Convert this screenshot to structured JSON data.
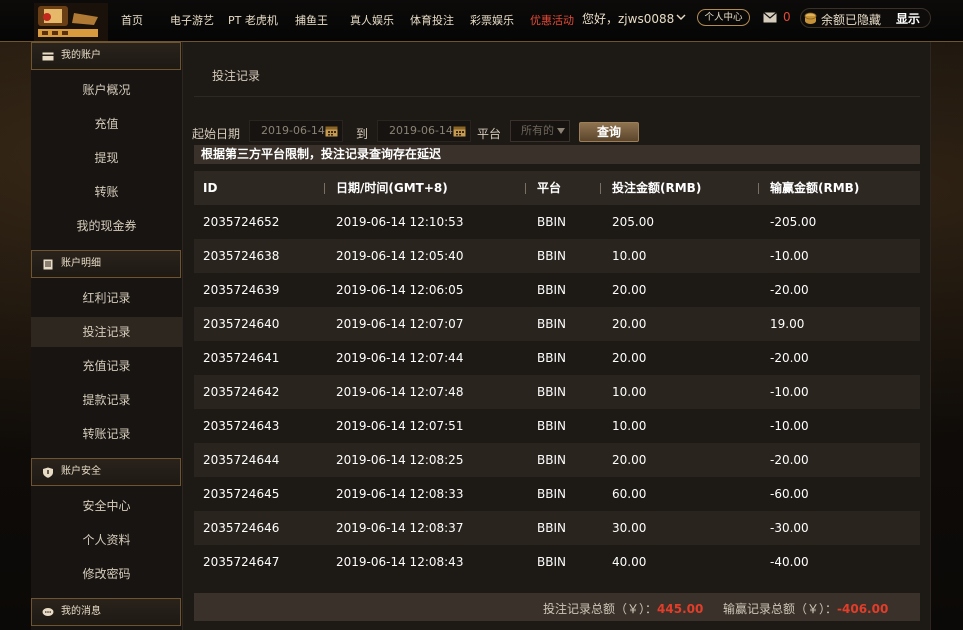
{
  "nav": {
    "items": [
      {
        "label": "首页",
        "promo": false
      },
      {
        "label": "电子游艺",
        "promo": false
      },
      {
        "label": "PT 老虎机",
        "promo": false
      },
      {
        "label": "捕鱼王",
        "promo": false
      },
      {
        "label": "真人娱乐",
        "promo": false
      },
      {
        "label": "体育投注",
        "promo": false
      },
      {
        "label": "彩票娱乐",
        "promo": false
      },
      {
        "label": "优惠活动",
        "promo": true
      }
    ],
    "greeting": "您好，zjws0088",
    "user_center": "个人中心",
    "mail_count": "0",
    "balance_text": "余额已隐藏",
    "show_label": "显示"
  },
  "sidebar": {
    "sections": [
      {
        "title": "我的账户",
        "icon": "card-icon",
        "items": [
          "账户概况",
          "充值",
          "提现",
          "转账",
          "我的现金券"
        ]
      },
      {
        "title": "账户明细",
        "icon": "ledger-icon",
        "items": [
          "红利记录",
          "投注记录",
          "充值记录",
          "提款记录",
          "转账记录"
        ]
      },
      {
        "title": "账户安全",
        "icon": "shield-icon",
        "items": [
          "安全中心",
          "个人资料",
          "修改密码"
        ]
      },
      {
        "title": "我的消息",
        "icon": "chat-icon",
        "items": []
      }
    ],
    "active_item": "投注记录"
  },
  "main": {
    "page_title": "投注记录",
    "filters": {
      "start_label": "起始日期",
      "start_date": "2019-06-14",
      "to_label": "到",
      "end_date": "2019-06-14",
      "platform_label": "平台",
      "platform_value": "所有的",
      "query_label": "查询"
    },
    "notice": "根据第三方平台限制，投注记录查询存在延迟",
    "table": {
      "headers": [
        "ID",
        "日期/时间(GMT+8)",
        "平台",
        "投注金额(RMB)",
        "输赢金额(RMB)"
      ],
      "rows": [
        [
          "2035724652",
          "2019-06-14 12:10:53",
          "BBIN",
          "205.00",
          "-205.00"
        ],
        [
          "2035724638",
          "2019-06-14 12:05:40",
          "BBIN",
          "10.00",
          "-10.00"
        ],
        [
          "2035724639",
          "2019-06-14 12:06:05",
          "BBIN",
          "20.00",
          "-20.00"
        ],
        [
          "2035724640",
          "2019-06-14 12:07:07",
          "BBIN",
          "20.00",
          "19.00"
        ],
        [
          "2035724641",
          "2019-06-14 12:07:44",
          "BBIN",
          "20.00",
          "-20.00"
        ],
        [
          "2035724642",
          "2019-06-14 12:07:48",
          "BBIN",
          "10.00",
          "-10.00"
        ],
        [
          "2035724643",
          "2019-06-14 12:07:51",
          "BBIN",
          "10.00",
          "-10.00"
        ],
        [
          "2035724644",
          "2019-06-14 12:08:25",
          "BBIN",
          "20.00",
          "-20.00"
        ],
        [
          "2035724645",
          "2019-06-14 12:08:33",
          "BBIN",
          "60.00",
          "-60.00"
        ],
        [
          "2035724646",
          "2019-06-14 12:08:37",
          "BBIN",
          "30.00",
          "-30.00"
        ],
        [
          "2035724647",
          "2019-06-14 12:08:43",
          "BBIN",
          "40.00",
          "-40.00"
        ]
      ]
    },
    "footer": {
      "bet_total_label": "投注记录总额（￥）：",
      "bet_total_value": "445.00",
      "win_total_label": "输赢记录总额（￥）：",
      "win_total_value": "-406.00"
    }
  },
  "colors": {
    "accent_gold": "#b28a52",
    "promo_red": "#e34a36",
    "total_red": "#e33d2a"
  }
}
